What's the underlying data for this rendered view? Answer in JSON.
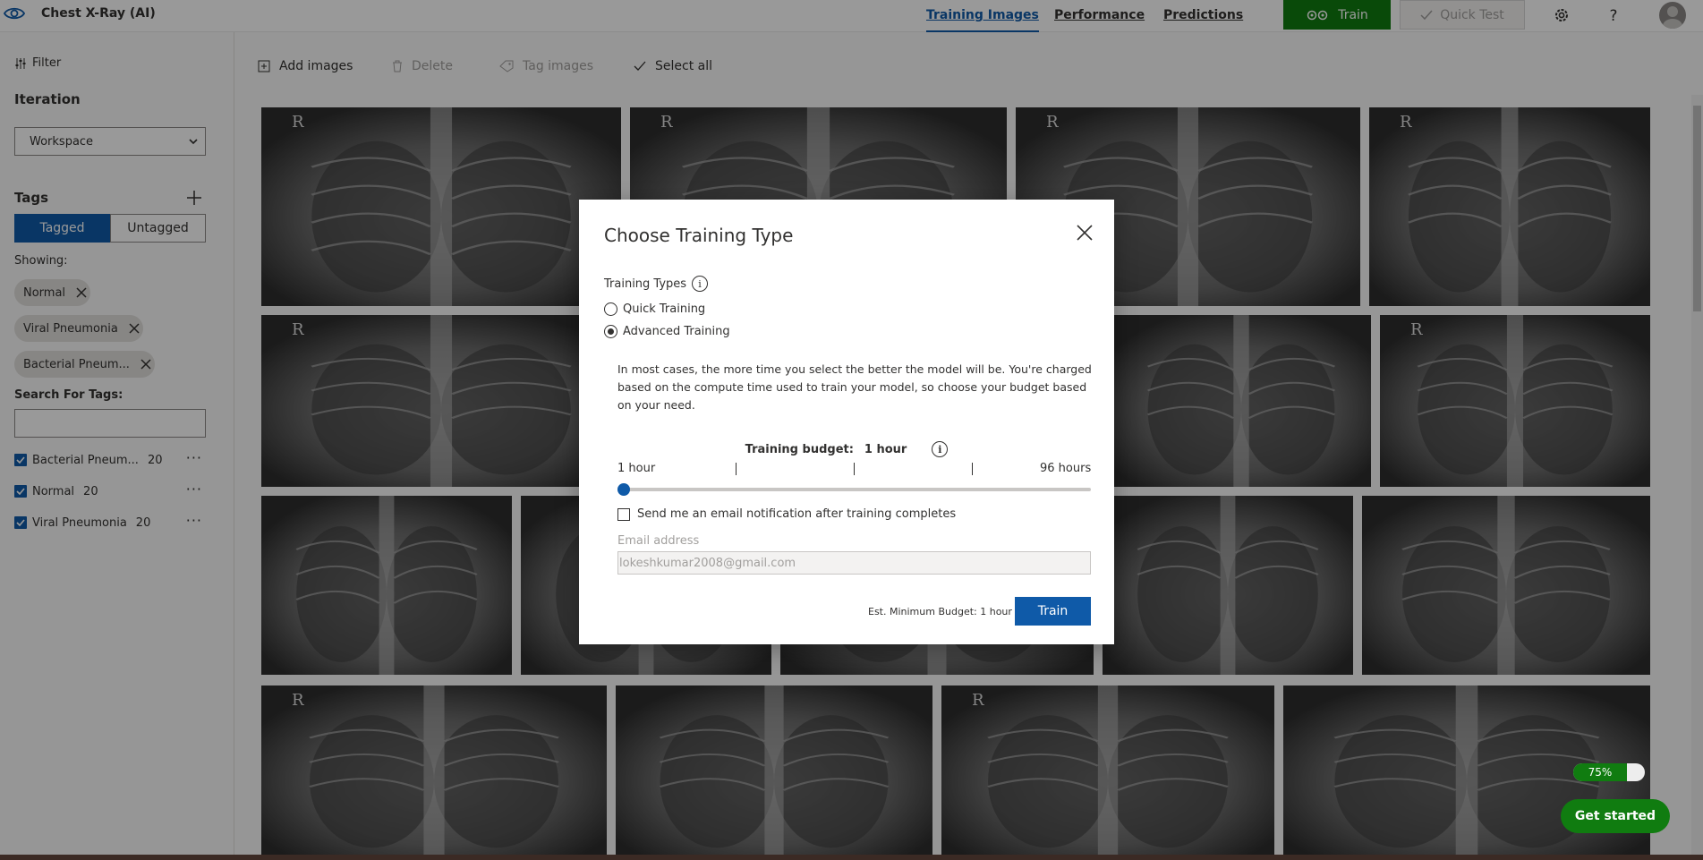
{
  "app": {
    "title": "Chest X-Ray (AI)"
  },
  "nav": {
    "tabs": [
      {
        "label": "Training Images",
        "active": true
      },
      {
        "label": "Performance"
      },
      {
        "label": "Predictions"
      }
    ],
    "train_label": "Train",
    "quick_test_label": "Quick Test"
  },
  "sidebar": {
    "filter_label": "Filter",
    "iteration_title": "Iteration",
    "iteration_value": "Workspace",
    "tags_title": "Tags",
    "tagged_label": "Tagged",
    "untagged_label": "Untagged",
    "showing_label": "Showing:",
    "chips": [
      "Normal",
      "Viral Pneumonia",
      "Bacterial Pneum..."
    ],
    "search_label": "Search For Tags:",
    "search_value": "",
    "tags": [
      {
        "name": "Bacterial Pneum...",
        "count": "20"
      },
      {
        "name": "Normal",
        "count": "20"
      },
      {
        "name": "Viral Pneumonia",
        "count": "20"
      }
    ]
  },
  "toolbar": {
    "add_images": "Add images",
    "delete": "Delete",
    "tag_images": "Tag images",
    "select_all": "Select all"
  },
  "grid": {
    "r_marker": "R"
  },
  "dialog": {
    "title": "Choose Training Type",
    "types_label": "Training Types",
    "quick_training": "Quick Training",
    "advanced_training": "Advanced Training",
    "selected_type": "Advanced Training",
    "description": "In most cases, the more time you select the better the model will be. You're charged based on the compute time used to train your model, so choose your budget based on your need.",
    "budget_label": "Training budget:",
    "budget_value": "1 hour",
    "slider_min": "1 hour",
    "slider_max": "96 hours",
    "notify_label": "Send me an email notification after training completes",
    "notify_checked": false,
    "email_label": "Email address",
    "email_value": "lokeshkumar2008@gmail.com",
    "est_budget": "Est. Minimum Budget: 1 hour",
    "train_button": "Train"
  },
  "progress": {
    "label": "75%",
    "value": 0.75
  },
  "get_started": "Get started",
  "colors": {
    "accent": "#0f5aa8",
    "green": "#107c10"
  }
}
